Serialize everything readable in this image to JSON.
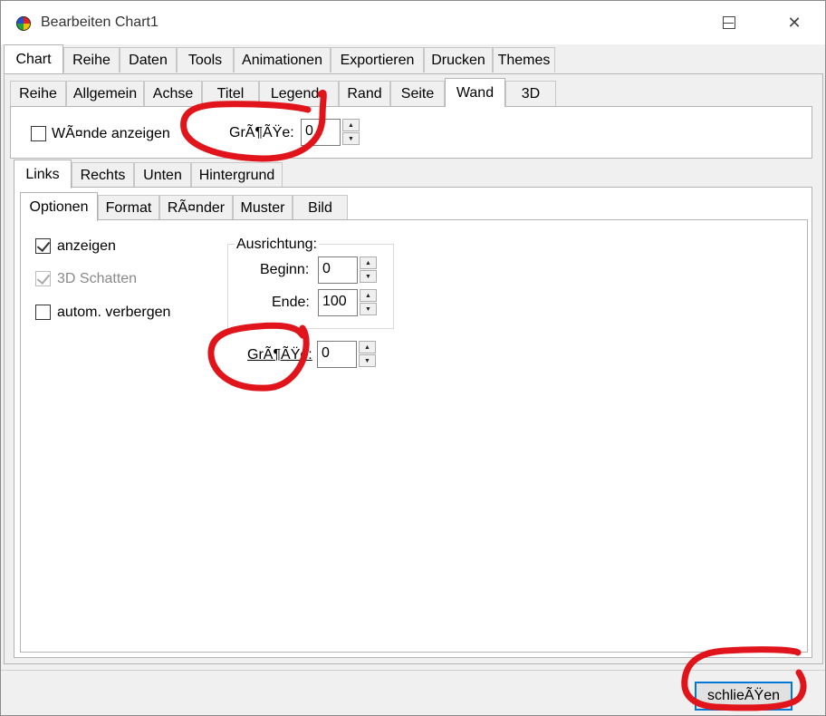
{
  "window": {
    "title": "Bearbeiten Chart1"
  },
  "main_tabs": [
    "Chart",
    "Reihe",
    "Daten",
    "Tools",
    "Animationen",
    "Exportieren",
    "Drucken",
    "Themes"
  ],
  "chart_tabs": [
    "Reihe",
    "Allgemein",
    "Achse",
    "Titel",
    "Legende",
    "Rand",
    "Seite",
    "Wand",
    "3D"
  ],
  "wand": {
    "show_walls_label": "WÃ¤nde anzeigen",
    "show_walls_checked": false,
    "size_label": "GrÃ¶ÃŸe:",
    "size_value": "0"
  },
  "wall_tabs": [
    "Links",
    "Rechts",
    "Unten",
    "Hintergrund"
  ],
  "option_tabs": [
    "Optionen",
    "Format",
    "RÃ¤nder",
    "Muster",
    "Bild"
  ],
  "options": {
    "show_label": "anzeigen",
    "show_checked": true,
    "shadow_label": "3D Schatten",
    "shadow_checked": true,
    "shadow_enabled": false,
    "autohide_label": "autom. verbergen",
    "autohide_checked": false,
    "alignment_title": "Ausrichtung:",
    "begin_label": "Beginn:",
    "begin_value": "0",
    "end_label": "Ende:",
    "end_value": "100",
    "size_label": "GrÃ¶ÃŸe:",
    "size_value": "0"
  },
  "footer": {
    "close_label": "schlieÃŸen"
  },
  "colors": {
    "annotation": "#e0141a",
    "focus_border": "#0078d7"
  }
}
